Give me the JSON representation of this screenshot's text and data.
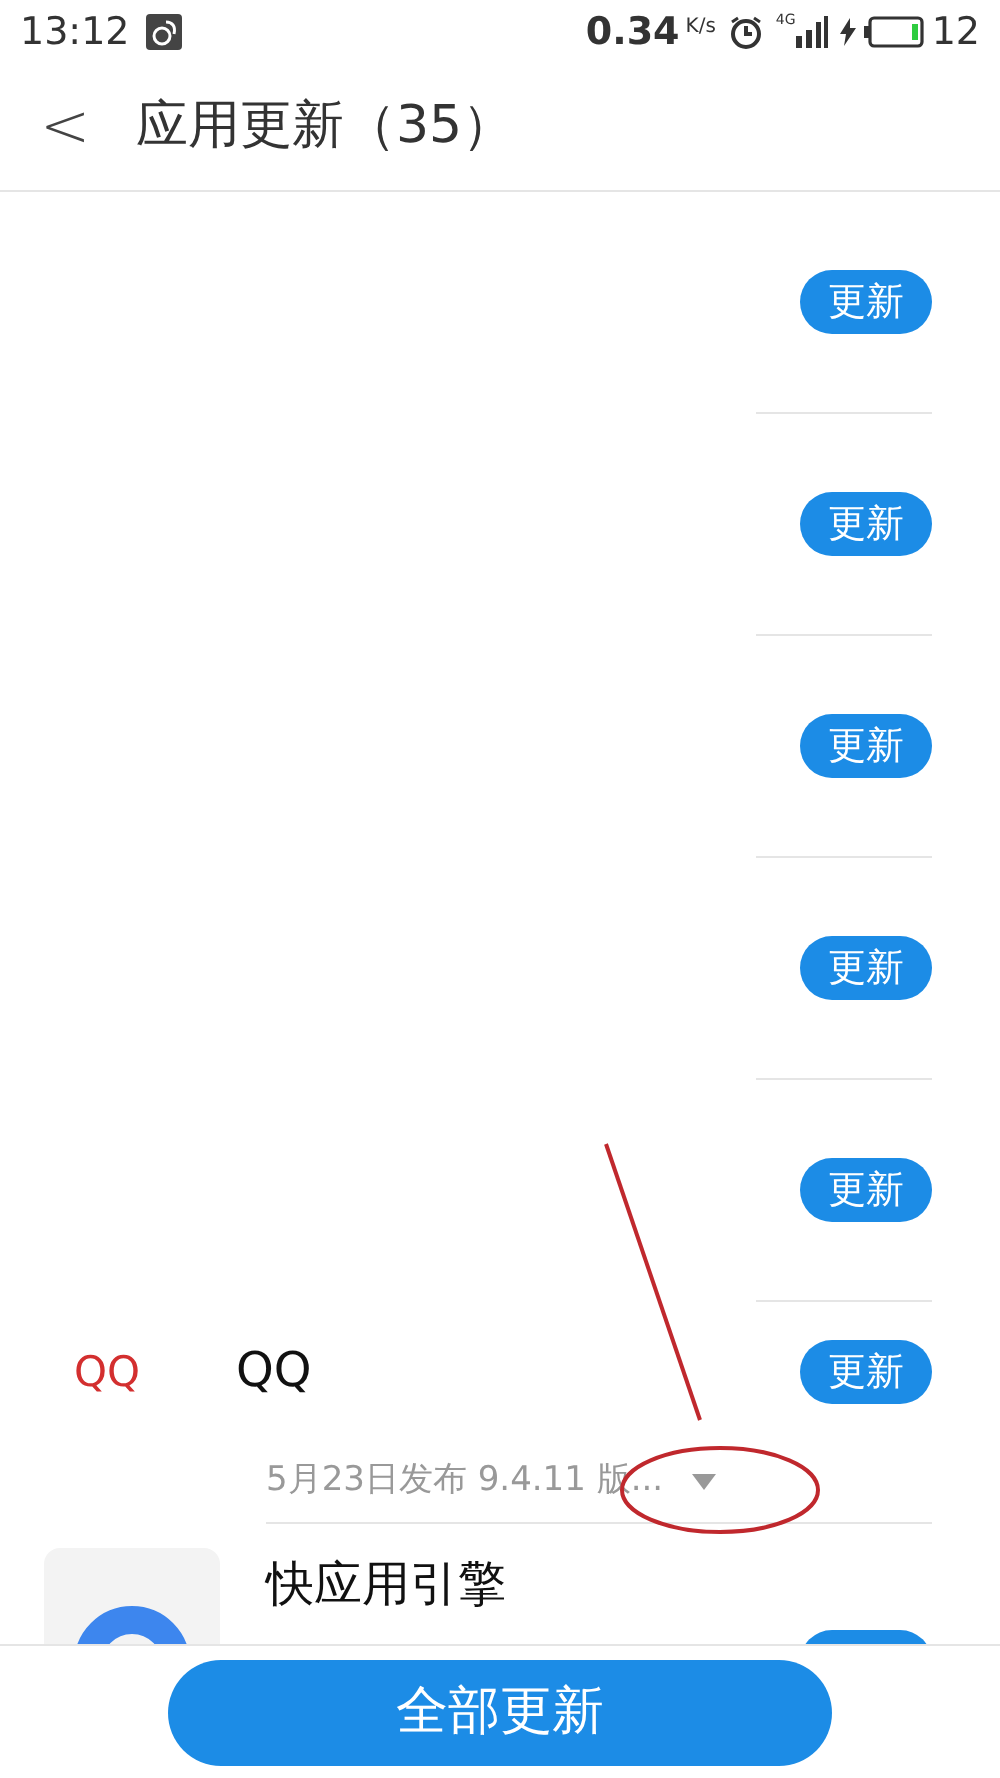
{
  "status_bar": {
    "time": "13:12",
    "speed": "0.34",
    "speed_unit": "K/s",
    "network": "4G",
    "battery": "12"
  },
  "header": {
    "back": "<",
    "title": "应用更新（35）"
  },
  "apps": [
    {
      "button": "更新"
    },
    {
      "button": "更新"
    },
    {
      "button": "更新"
    },
    {
      "button": "更新"
    },
    {
      "button": "更新"
    },
    {
      "icon_alt": "QQ",
      "name": "QQ",
      "subtitle": "5月23日发布 9.4.11 版...",
      "button": "更新"
    },
    {
      "name": "快应用引擎",
      "icon": true
    }
  ],
  "update_all": "全部更新"
}
